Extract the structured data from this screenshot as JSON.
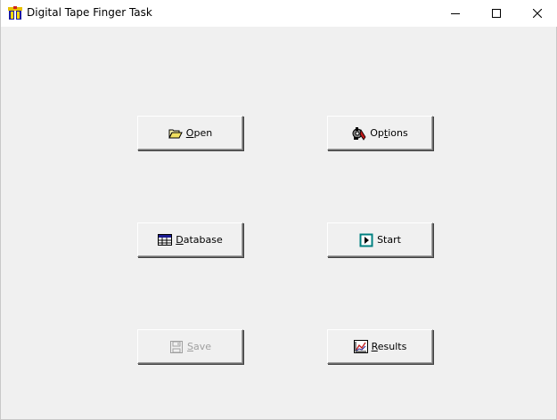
{
  "window": {
    "title": "Digital Tape Finger Task",
    "app_icon": "app-icon"
  },
  "caption_buttons": {
    "minimize_icon": "minimize-icon",
    "maximize_icon": "maximize-icon",
    "close_icon": "close-icon"
  },
  "buttons": {
    "open": {
      "accel": "O",
      "rest": "pen",
      "icon": "folder-open-icon",
      "enabled": true
    },
    "options": {
      "pre": "Op",
      "accel": "t",
      "rest": "ions",
      "icon": "options-tools-icon",
      "enabled": true
    },
    "database": {
      "accel": "D",
      "rest": "atabase",
      "icon": "database-grid-icon",
      "enabled": true
    },
    "start": {
      "label": "Start",
      "icon": "play-icon",
      "enabled": true
    },
    "save": {
      "accel": "S",
      "rest": "ave",
      "icon": "floppy-disk-icon",
      "enabled": false
    },
    "results": {
      "accel": "R",
      "rest": "esults",
      "icon": "chart-icon",
      "enabled": true
    }
  },
  "colors": {
    "window_bg": "#f0f0f0",
    "titlebar_bg": "#ffffff",
    "disabled_text": "#a0a0a0"
  }
}
